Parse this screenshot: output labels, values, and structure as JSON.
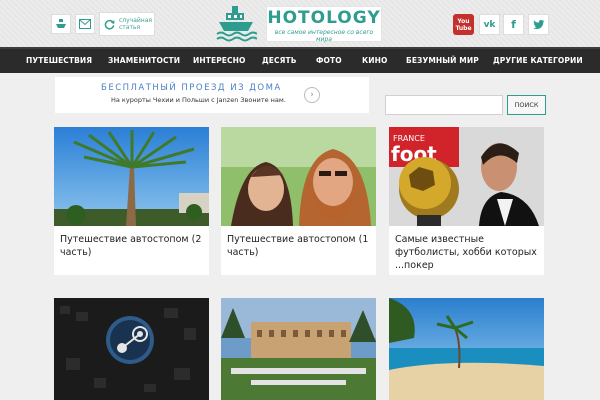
{
  "header": {
    "random_article": "случайная\nстатья",
    "logo_title": "HOTOLOGY",
    "logo_subtitle": "все самое интересное со всего мира",
    "icons": [
      "ship-icon",
      "mail-icon",
      "refresh-icon"
    ],
    "social": {
      "youtube": "You\nTube",
      "vk": "vk",
      "facebook": "f",
      "twitter": "t"
    },
    "colors": {
      "accent": "#2e9d90",
      "youtube": "#c4302b"
    }
  },
  "nav": {
    "items": [
      "ПУТЕШЕСТВИЯ",
      "ЗНАМЕНИТОСТИ",
      "ИНТЕРЕСНО",
      "ДЕСЯТЬ",
      "ФОТО",
      "КИНО",
      "БЕЗУМНЫЙ МИР",
      "ДРУГИЕ КАТЕГОРИИ"
    ]
  },
  "ad": {
    "title": "БЕСПЛАТНЫЙ ПРОЕЗД ИЗ ДОМА",
    "subtitle": "На курорты Чехии и Польши с Janzen Звоните нам."
  },
  "search": {
    "placeholder": "",
    "button": "ПОИСК"
  },
  "cards": [
    {
      "title": "Путешествие автостопом (2 часть)"
    },
    {
      "title": "Путешествие автостопом (1 часть)"
    },
    {
      "title": "Самые известные футболисты, хобби которых ...покер"
    },
    {
      "title": ""
    },
    {
      "title": ""
    },
    {
      "title": ""
    }
  ]
}
